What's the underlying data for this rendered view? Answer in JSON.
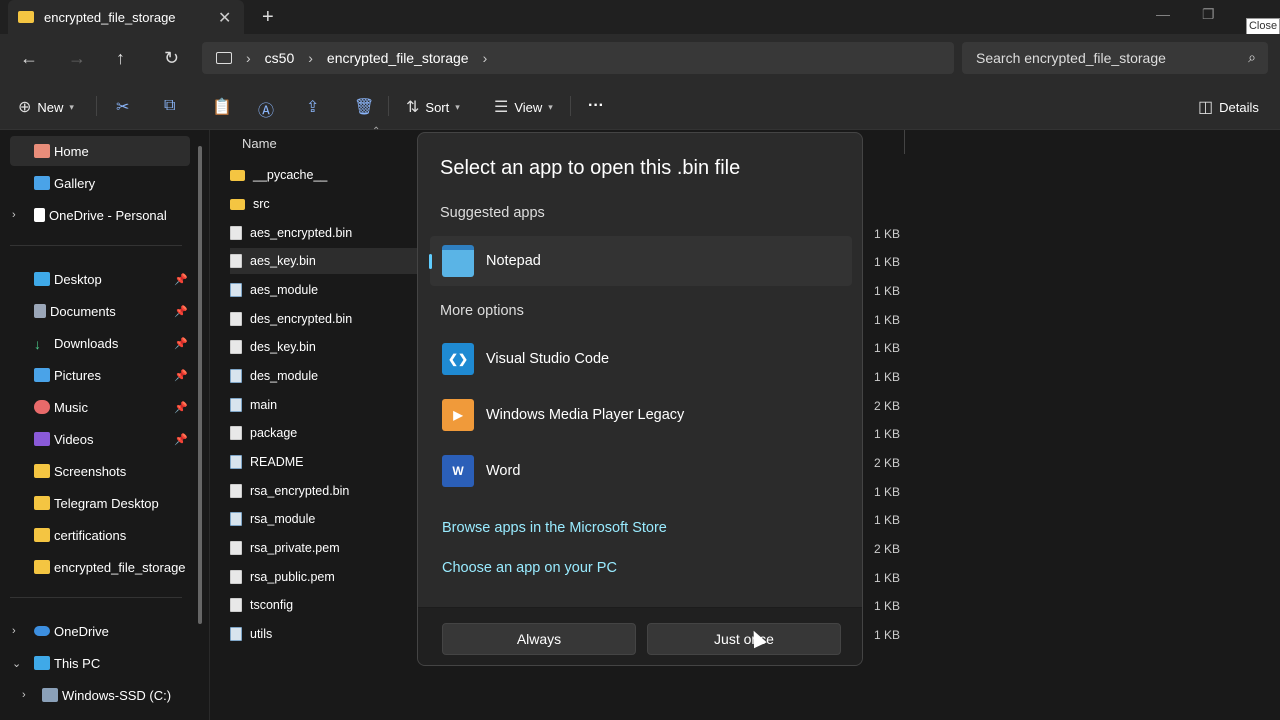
{
  "window": {
    "tab_title": "encrypted_file_storage",
    "close_tooltip": "Close"
  },
  "address": {
    "crumbs": [
      "cs50",
      "encrypted_file_storage"
    ],
    "search_placeholder": "Search encrypted_file_storage"
  },
  "toolbar": {
    "new": "New",
    "sort": "Sort",
    "view": "View",
    "more": "···",
    "details": "Details"
  },
  "sidebar": {
    "items": [
      {
        "label": "Home"
      },
      {
        "label": "Gallery"
      },
      {
        "label": "OneDrive - Personal"
      },
      {
        "label": "Desktop"
      },
      {
        "label": "Documents"
      },
      {
        "label": "Downloads"
      },
      {
        "label": "Pictures"
      },
      {
        "label": "Music"
      },
      {
        "label": "Videos"
      },
      {
        "label": "Screenshots"
      },
      {
        "label": "Telegram Desktop"
      },
      {
        "label": "certifications"
      },
      {
        "label": "encrypted_file_storage"
      },
      {
        "label": "OneDrive"
      },
      {
        "label": "This PC"
      },
      {
        "label": "Windows-SSD (C:)"
      }
    ]
  },
  "files": {
    "column_name": "Name",
    "rows": [
      {
        "name": "__pycache__",
        "size": ""
      },
      {
        "name": "src",
        "size": ""
      },
      {
        "name": "aes_encrypted.bin",
        "size": "1 KB"
      },
      {
        "name": "aes_key.bin",
        "size": "1 KB"
      },
      {
        "name": "aes_module",
        "size": "1 KB"
      },
      {
        "name": "des_encrypted.bin",
        "size": "1 KB"
      },
      {
        "name": "des_key.bin",
        "size": "1 KB"
      },
      {
        "name": "des_module",
        "size": "1 KB"
      },
      {
        "name": "main",
        "size": "2 KB"
      },
      {
        "name": "package",
        "size": "1 KB"
      },
      {
        "name": "README",
        "size": "2 KB"
      },
      {
        "name": "rsa_encrypted.bin",
        "size": "1 KB"
      },
      {
        "name": "rsa_module",
        "size": "1 KB"
      },
      {
        "name": "rsa_private.pem",
        "size": "2 KB"
      },
      {
        "name": "rsa_public.pem",
        "size": "1 KB"
      },
      {
        "name": "tsconfig",
        "size": "1 KB"
      },
      {
        "name": "utils",
        "size": "1 KB"
      }
    ]
  },
  "dialog": {
    "title": "Select an app to open this .bin file",
    "suggested_label": "Suggested apps",
    "suggested": [
      {
        "name": "Notepad"
      }
    ],
    "more_label": "More options",
    "more": [
      {
        "name": "Visual Studio Code"
      },
      {
        "name": "Windows Media Player Legacy"
      },
      {
        "name": "Word"
      }
    ],
    "link_store": "Browse apps in the Microsoft Store",
    "link_pc": "Choose an app on your PC",
    "btn_always": "Always",
    "btn_once": "Just once"
  }
}
